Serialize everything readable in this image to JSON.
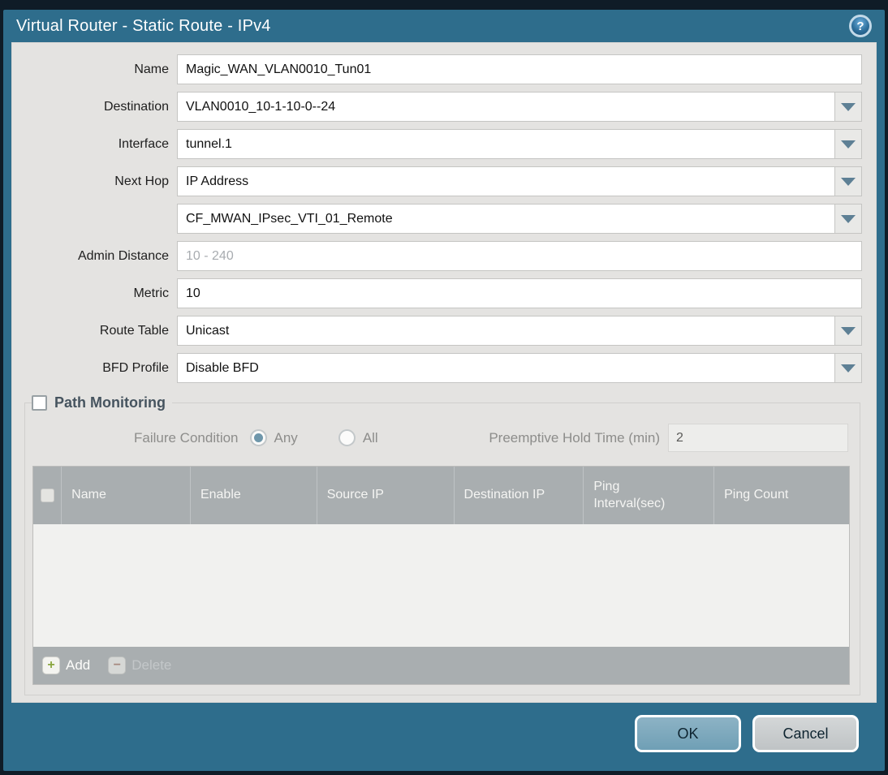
{
  "window": {
    "title": "Virtual Router - Static Route - IPv4"
  },
  "icons": {
    "help_glyph": "?",
    "plus_glyph": "+",
    "minus_glyph": "−"
  },
  "form": {
    "fields": [
      {
        "label": "Name",
        "value": "Magic_WAN_VLAN0010_Tun01",
        "type": "text"
      },
      {
        "label": "Destination",
        "value": "VLAN0010_10-1-10-0--24",
        "type": "dropdown"
      },
      {
        "label": "Interface",
        "value": "tunnel.1",
        "type": "dropdown"
      },
      {
        "label": "Next Hop",
        "value": "IP Address",
        "type": "dropdown"
      },
      {
        "label": "",
        "value": "CF_MWAN_IPsec_VTI_01_Remote",
        "type": "dropdown"
      },
      {
        "label": "Admin Distance",
        "value": "",
        "placeholder": "10 - 240",
        "type": "text"
      },
      {
        "label": "Metric",
        "value": "10",
        "type": "text"
      },
      {
        "label": "Route Table",
        "value": "Unicast",
        "type": "dropdown"
      },
      {
        "label": "BFD Profile",
        "value": "Disable BFD",
        "type": "dropdown"
      }
    ]
  },
  "path_monitoring": {
    "title": "Path Monitoring",
    "checked": false,
    "failure_condition": {
      "label": "Failure Condition",
      "options": [
        {
          "label": "Any",
          "selected": true
        },
        {
          "label": "All",
          "selected": false
        }
      ]
    },
    "preemptive_hold_time": {
      "label": "Preemptive Hold Time (min)",
      "value": "2"
    },
    "table": {
      "columns": [
        "Name",
        "Enable",
        "Source IP",
        "Destination IP",
        "Ping Interval(sec)",
        "Ping Count"
      ],
      "rows": []
    },
    "toolbar": {
      "add_label": "Add",
      "delete_label": "Delete"
    }
  },
  "footer": {
    "ok_label": "OK",
    "cancel_label": "Cancel"
  },
  "colors": {
    "frame_teal": "#2e6d8c",
    "outer_border": "#0f1c27",
    "content_bg": "#e4e3e1",
    "table_header_bg": "#a9aeb0",
    "table_body_bg": "#f1f1ef",
    "ok_button": "#7aa6ba",
    "cancel_button": "#c7cacc",
    "radio_selected": "#6f97ab",
    "section_title": "#46545f",
    "add_icon_green": "#8aa63f",
    "delete_icon_red": "#a5705f"
  }
}
